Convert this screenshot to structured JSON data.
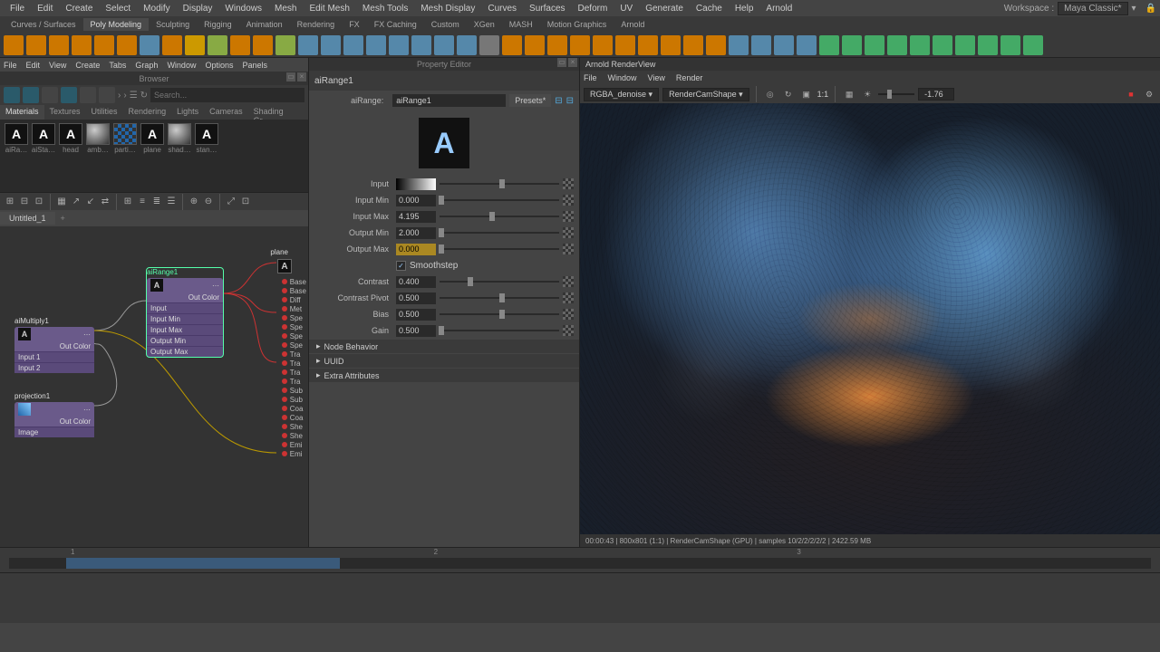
{
  "menubar": [
    "File",
    "Edit",
    "Create",
    "Select",
    "Modify",
    "Display",
    "Windows",
    "Mesh",
    "Edit Mesh",
    "Mesh Tools",
    "Mesh Display",
    "Curves",
    "Surfaces",
    "Deform",
    "UV",
    "Generate",
    "Cache",
    "Help",
    "Arnold"
  ],
  "workspace": {
    "label": "Workspace :",
    "value": "Maya Classic*"
  },
  "shelfTabs": [
    "Curves / Surfaces",
    "Poly Modeling",
    "Sculpting",
    "Rigging",
    "Animation",
    "Rendering",
    "FX",
    "FX Caching",
    "Custom",
    "XGen",
    "MASH",
    "Motion Graphics",
    "Arnold"
  ],
  "activeShelfTab": 1,
  "panelMenu": [
    "File",
    "Edit",
    "View",
    "Create",
    "Tabs",
    "Graph",
    "Window",
    "Options",
    "Panels"
  ],
  "browser": {
    "title": "Browser",
    "searchPlaceholder": "Search..."
  },
  "matTabs": [
    "Materials",
    "Textures",
    "Utilities",
    "Rendering",
    "Lights",
    "Cameras",
    "Shading Gr…"
  ],
  "swatches": [
    {
      "label": "aiRa…",
      "type": "A"
    },
    {
      "label": "aiSta…",
      "type": "A"
    },
    {
      "label": "head",
      "type": "A"
    },
    {
      "label": "amb…",
      "type": "sphere"
    },
    {
      "label": "parti…",
      "type": "check"
    },
    {
      "label": "plane",
      "type": "A"
    },
    {
      "label": "shad…",
      "type": "sphere"
    },
    {
      "label": "stan…",
      "type": "A"
    }
  ],
  "hsTab": "Untitled_1",
  "nodes": {
    "aiRange": {
      "title": "aiRange1",
      "out": "Out Color",
      "attrs": [
        "Input",
        "Input Min",
        "Input Max",
        "Output Min",
        "Output Max"
      ]
    },
    "aiMultiply": {
      "title": "aiMultiply1",
      "out": "Out Color",
      "attrs": [
        "Input 1",
        "Input 2"
      ]
    },
    "projection": {
      "title": "projection1",
      "out": "Out Color",
      "attrs": [
        "Image"
      ]
    },
    "plane": {
      "title": "plane",
      "attrs": [
        "Base",
        "Base",
        "Diff",
        "Met",
        "Spe",
        "Spe",
        "Spe",
        "Spe",
        "Tra",
        "Tra",
        "Tra",
        "Tra",
        "Sub",
        "Sub",
        "Coa",
        "Coa",
        "She",
        "She",
        "Emi",
        "Emi"
      ]
    }
  },
  "propertyEditor": {
    "title": "Property Editor",
    "headerNode": "aiRange1",
    "typeLabel": "aiRange:",
    "nodeName": "aiRange1",
    "presets": "Presets*",
    "attrs": [
      {
        "label": "Input",
        "value": "",
        "pos": 50,
        "grad": true
      },
      {
        "label": "Input Min",
        "value": "0.000",
        "pos": 2
      },
      {
        "label": "Input Max",
        "value": "4.195",
        "pos": 42
      },
      {
        "label": "Output Min",
        "value": "2.000",
        "pos": 2
      },
      {
        "label": "Output Max",
        "value": "0.000",
        "pos": 2,
        "hl": true
      },
      {
        "label": "",
        "checkbox": true,
        "checkLabel": "Smoothstep",
        "checked": true
      },
      {
        "label": "Contrast",
        "value": "0.400",
        "pos": 25
      },
      {
        "label": "Contrast Pivot",
        "value": "0.500",
        "pos": 50
      },
      {
        "label": "Bias",
        "value": "0.500",
        "pos": 50
      },
      {
        "label": "Gain",
        "value": "0.500",
        "pos": 2
      }
    ],
    "sections": [
      "Node Behavior",
      "UUID",
      "Extra Attributes"
    ]
  },
  "renderView": {
    "title": "Arnold RenderView",
    "menu": [
      "File",
      "Window",
      "View",
      "Render"
    ],
    "aov": "RGBA_denoise",
    "cam": "RenderCamShape",
    "ratio": "1:1",
    "exposure": "-1.76",
    "status": "00:00:43 | 800x801 (1:1) | RenderCamShape  (GPU) | samples 10/2/2/2/2/2 | 2422.59 MB"
  },
  "timeline": {
    "marks": [
      "1",
      "2",
      "3"
    ]
  }
}
